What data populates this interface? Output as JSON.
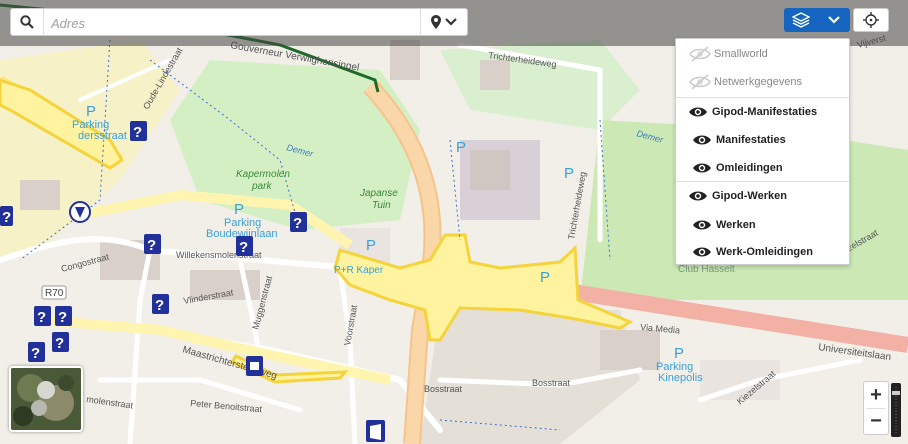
{
  "search": {
    "placeholder": "Adres"
  },
  "layers": [
    {
      "label": "Smallworld",
      "visible": false,
      "level": 0
    },
    {
      "label": "Netwerkgegevens",
      "visible": false,
      "level": 0
    },
    {
      "label": "Gipod-Manifestaties",
      "visible": true,
      "level": 0
    },
    {
      "label": "Manifestaties",
      "visible": true,
      "level": 1
    },
    {
      "label": "Omleidingen",
      "visible": true,
      "level": 1
    },
    {
      "label": "Gipod-Werken",
      "visible": true,
      "level": 0
    },
    {
      "label": "Werken",
      "visible": true,
      "level": 1
    },
    {
      "label": "Werk-Omleidingen",
      "visible": true,
      "level": 1
    }
  ],
  "map_labels": {
    "parking_1": "Parking",
    "parking_1b": "dersstraat",
    "parking_2": "Parking",
    "parking_2b": "Boudewijnlaan",
    "kapermolen": "Kapermolen",
    "kapermolen_b": "park",
    "japanse": "Japanse",
    "japanse_b": "Tuin",
    "pr_kaper": "P+R Kaper",
    "gouverneur": "Gouverneur Verwilghensingel",
    "trichterheide": "Trichterheideweg",
    "trichterheide_v": "Trichterheideweg",
    "demer1": "Demer",
    "demer2": "Demer",
    "club": "Club Hasselt",
    "viamedia": "Via Media",
    "universiteitslaan": "Universiteitslaan",
    "kinepolis": "Parking",
    "kinepolis_b": "Kinepolis",
    "bosstraat1": "Bosstraat",
    "bosstraat2": "Bosstraat",
    "maastrichtersteenweg": "Maastrichtersteenweg",
    "peter": "Peter Benoitstraat",
    "molenstraat": "molenstraat",
    "willekens": "Willekensmolenstraat",
    "congostraat": "Congostraat",
    "vlinderstraat": "Vlinderstraat",
    "muggenstraat": "Muggenstraat",
    "voorstraat": "Voorstraat",
    "r70": "R70",
    "kiezel1": "Kiezelstraat",
    "kiezel2": "Kiezelstraat",
    "oude": "Oude-Lindestraat",
    "vijverst": "Vijverst",
    "p_plain": "P"
  },
  "colors": {
    "accent": "#1565c0",
    "highway": "#fde680",
    "road_pink": "#f2b1a4",
    "marker": "#22319a"
  }
}
